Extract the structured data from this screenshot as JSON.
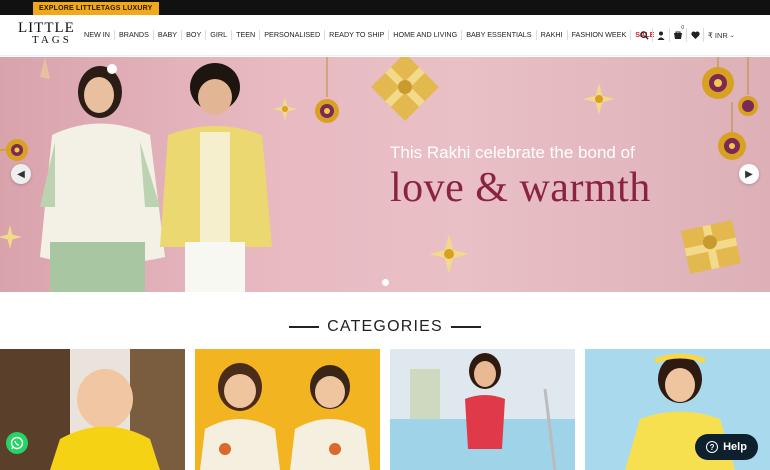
{
  "topbar": {
    "luxury_label": "EXPLORE LITTLETAGS LUXURY"
  },
  "logo": {
    "line1": "LITTLE",
    "line2": "TAGS"
  },
  "nav": {
    "items": [
      "NEW IN",
      "BRANDS",
      "BABY",
      "BOY",
      "GIRL",
      "TEEN",
      "PERSONALISED",
      "READY TO SHIP",
      "HOME AND LIVING",
      "BABY ESSENTIALS",
      "RAKHI",
      "FASHION WEEK"
    ],
    "sale": "SALE"
  },
  "header_icons": {
    "search": "search-icon",
    "account": "user-icon",
    "cart": "cart-icon",
    "cart_count": "0",
    "wishlist": "heart-icon",
    "currency": "₹ INR"
  },
  "banner": {
    "tagline": "This Rakhi celebrate the bond of",
    "headline": "love & warmth",
    "slide_count": 1,
    "active_slide": 1
  },
  "categories": {
    "title": "CATEGORIES"
  },
  "colors": {
    "accent": "#f0a81d",
    "sale": "#d21f2a",
    "headline": "#8a2340",
    "whatsapp": "#25d366",
    "help": "#0e1f2e"
  },
  "help": {
    "label": "Help"
  }
}
